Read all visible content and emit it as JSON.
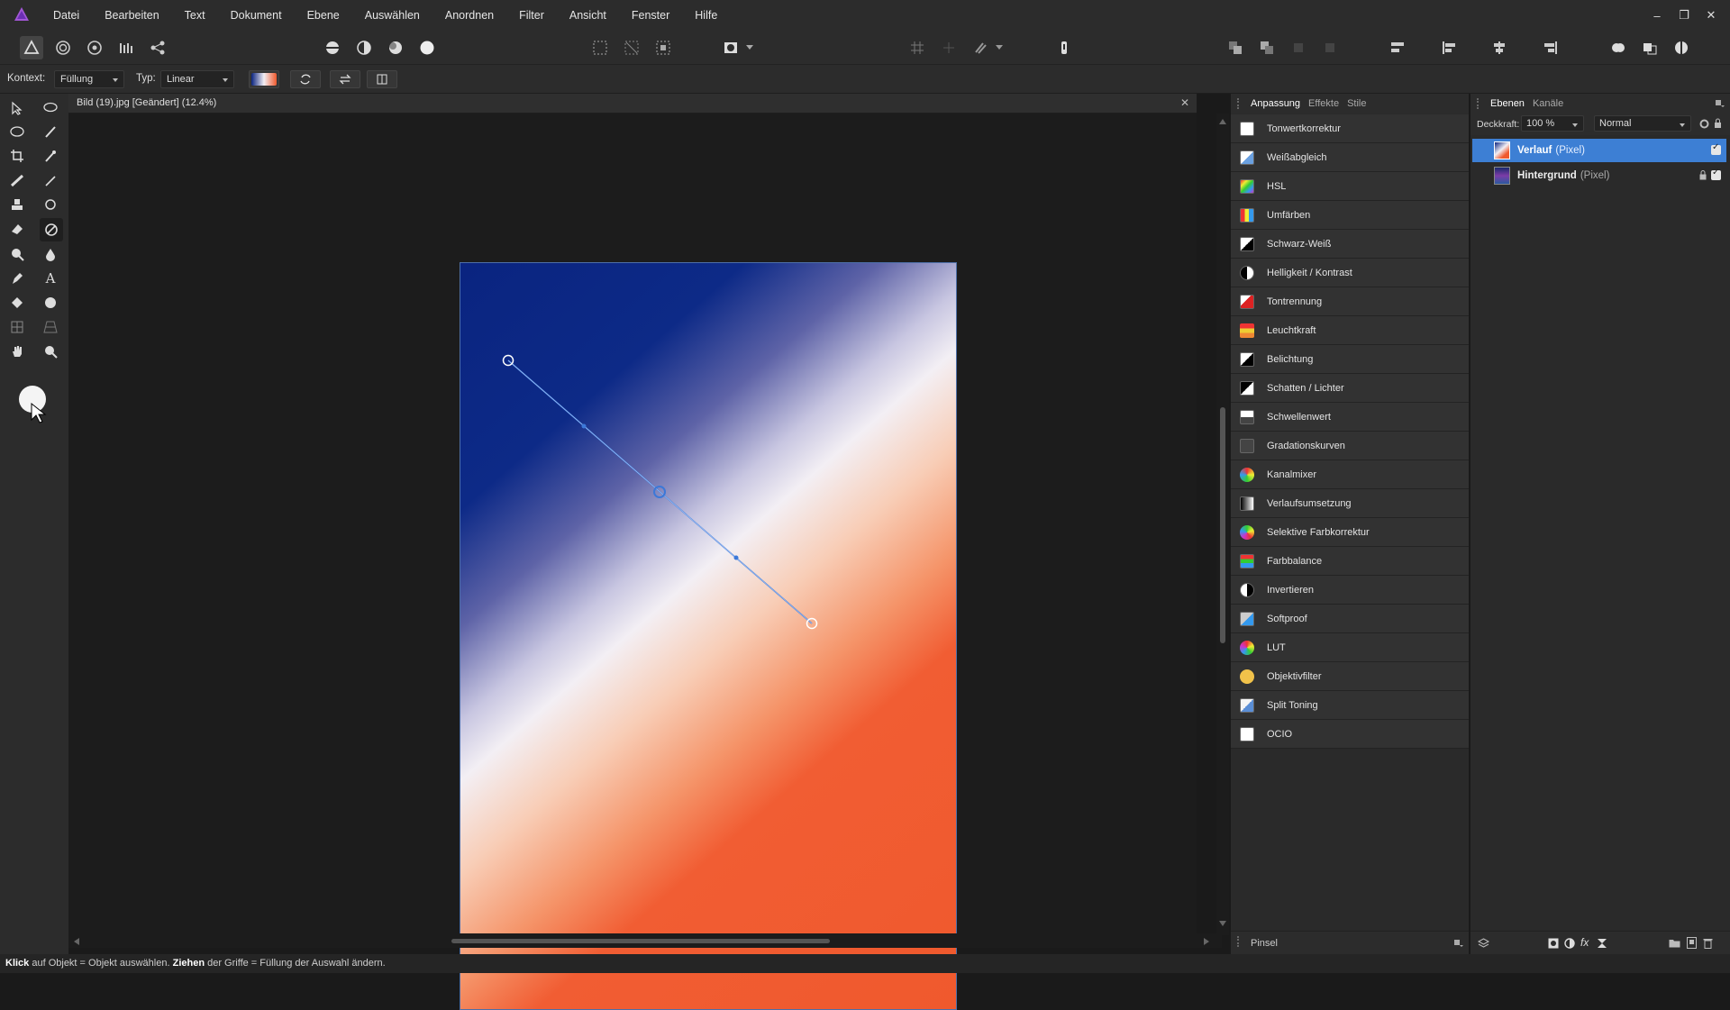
{
  "app": {
    "document_title": "Bild (19).jpg [Geändert] (12.4%)"
  },
  "menu": [
    "Datei",
    "Bearbeiten",
    "Text",
    "Dokument",
    "Ebene",
    "Auswählen",
    "Anordnen",
    "Filter",
    "Ansicht",
    "Fenster",
    "Hilfe"
  ],
  "context": {
    "kontext_label": "Kontext:",
    "kontext_value": "Füllung",
    "typ_label": "Typ:",
    "typ_value": "Linear"
  },
  "adjust_panel": {
    "tabs": [
      "Anpassung",
      "Effekte",
      "Stile"
    ],
    "items": [
      "Tonwertkorrektur",
      "Weißabgleich",
      "HSL",
      "Umfärben",
      "Schwarz-Weiß",
      "Helligkeit / Kontrast",
      "Tontrennung",
      "Leuchtkraft",
      "Belichtung",
      "Schatten / Lichter",
      "Schwellenwert",
      "Gradationskurven",
      "Kanalmixer",
      "Verlaufsumsetzung",
      "Selektive Farbkorrektur",
      "Farbbalance",
      "Invertieren",
      "Softproof",
      "LUT",
      "Objektivfilter",
      "Split Toning",
      "OCIO"
    ],
    "footer_label": "Pinsel"
  },
  "layers_panel": {
    "tabs": [
      "Ebenen",
      "Kanäle"
    ],
    "opacity_label": "Deckkraft:",
    "opacity_value": "100 %",
    "blend_mode": "Normal",
    "layers": [
      {
        "name": "Verlauf",
        "type": "(Pixel)",
        "selected": true
      },
      {
        "name": "Hintergrund",
        "type": "(Pixel)",
        "selected": false
      }
    ]
  },
  "status": {
    "klick": "Klick",
    "part1": " auf Objekt = Objekt auswählen. ",
    "ziehen": "Ziehen",
    "part2": " der Griffe = Füllung der Auswahl ändern."
  },
  "colors": {
    "accent": "#3c78d8",
    "gradient_start": "#0a2480",
    "gradient_mid": "#f3eff4",
    "gradient_end": "#f0592d"
  }
}
